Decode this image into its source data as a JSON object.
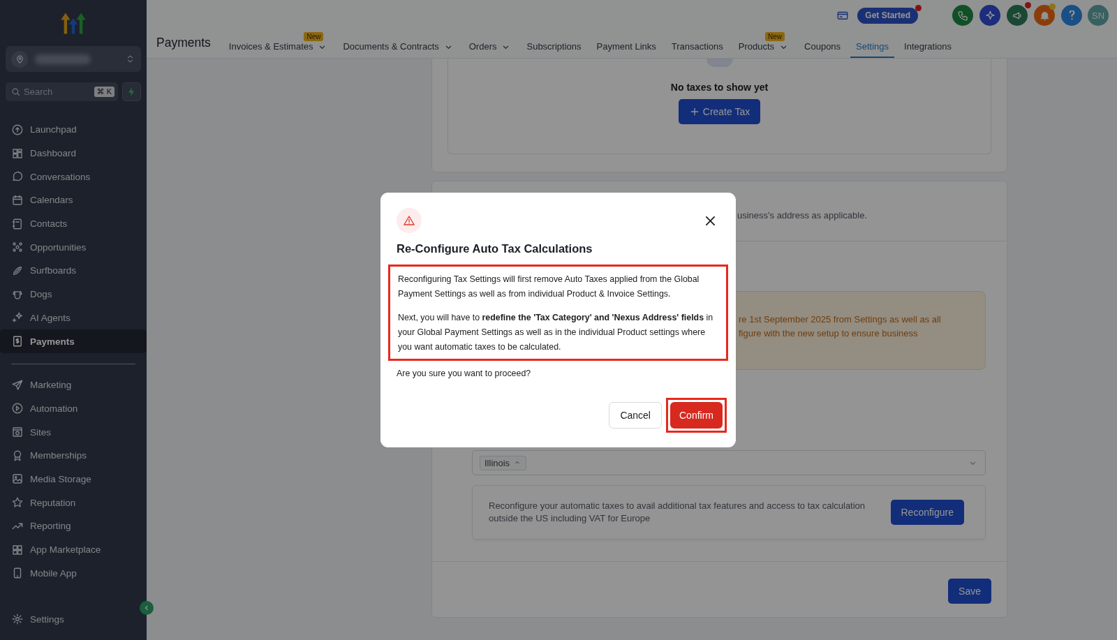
{
  "sidebar": {
    "search": {
      "placeholder": "Search",
      "shortcut": "⌘ K"
    },
    "primary_items": [
      {
        "label": "Launchpad",
        "selected": false
      },
      {
        "label": "Dashboard",
        "selected": false
      },
      {
        "label": "Conversations",
        "selected": false
      },
      {
        "label": "Calendars",
        "selected": false
      },
      {
        "label": "Contacts",
        "selected": false
      },
      {
        "label": "Opportunities",
        "selected": false
      },
      {
        "label": "Surfboards",
        "selected": false
      },
      {
        "label": "Dogs",
        "selected": false
      },
      {
        "label": "AI Agents",
        "selected": false
      },
      {
        "label": "Payments",
        "selected": true
      }
    ],
    "secondary_items": [
      {
        "label": "Marketing",
        "selected": false
      },
      {
        "label": "Automation",
        "selected": false
      },
      {
        "label": "Sites",
        "selected": false
      },
      {
        "label": "Memberships",
        "selected": false
      },
      {
        "label": "Media Storage",
        "selected": false
      },
      {
        "label": "Reputation",
        "selected": false
      },
      {
        "label": "Reporting",
        "selected": false
      },
      {
        "label": "App Marketplace",
        "selected": false
      },
      {
        "label": "Mobile App",
        "selected": false
      }
    ],
    "settings": {
      "label": "Settings"
    }
  },
  "header": {
    "title": "Payments",
    "tabs": [
      {
        "label": "Invoices & Estimates",
        "badge": "New",
        "dropdown": true,
        "selected": false
      },
      {
        "label": "Documents & Contracts",
        "dropdown": true,
        "selected": false
      },
      {
        "label": "Orders",
        "dropdown": true,
        "selected": false
      },
      {
        "label": "Subscriptions",
        "dropdown": false,
        "selected": false
      },
      {
        "label": "Payment Links",
        "dropdown": false,
        "selected": false
      },
      {
        "label": "Transactions",
        "dropdown": false,
        "selected": false
      },
      {
        "label": "Products",
        "badge": "New",
        "dropdown": true,
        "selected": false
      },
      {
        "label": "Coupons",
        "dropdown": false,
        "selected": false
      },
      {
        "label": "Settings",
        "dropdown": false,
        "selected": true
      },
      {
        "label": "Integrations",
        "dropdown": false,
        "selected": false
      }
    ],
    "get_started": {
      "label": "Get Started",
      "notification": true
    },
    "actions": [
      {
        "kind": "phone",
        "notification": false
      },
      {
        "kind": "sparkle",
        "notification": false
      },
      {
        "kind": "megaphone",
        "notification": true
      },
      {
        "kind": "bell",
        "notification": true
      },
      {
        "kind": "help",
        "notification": false
      }
    ],
    "avatar": {
      "initials": "SN"
    }
  },
  "content": {
    "empty_state": "No taxes to show yet",
    "create_button": "Create Tax",
    "address_text": "usiness's address as applicable.",
    "notice_lines": [
      "re 1st September 2025 from Settings as well as all",
      "figure with the new setup to ensure business"
    ],
    "state_tags": [
      "Illinois"
    ],
    "reconfigure_text": "Reconfigure your automatic taxes to avail additional tax features and access to tax calculation outside the US including VAT for Europe",
    "reconfigure_button": "Reconfigure",
    "save_button": "Save"
  },
  "modal": {
    "title": "Re-Configure Auto Tax Calculations",
    "paragraphs": [
      "Reconfiguring Tax Settings will first remove Auto Taxes applied from the Global Payment Settings as well as from individual Product & Invoice Settings.",
      "Next, you will have to **redefine the 'Tax Category' and 'Nexus Address' fields** in your Global Payment Settings as well as in the individual Product settings where you want automatic taxes to be calculated."
    ],
    "paragraphs_highlighted": true,
    "question": "Are you sure you want to proceed?",
    "cancel_button": "Cancel",
    "confirm_button": {
      "label": "Confirm",
      "highlighted": true
    }
  }
}
